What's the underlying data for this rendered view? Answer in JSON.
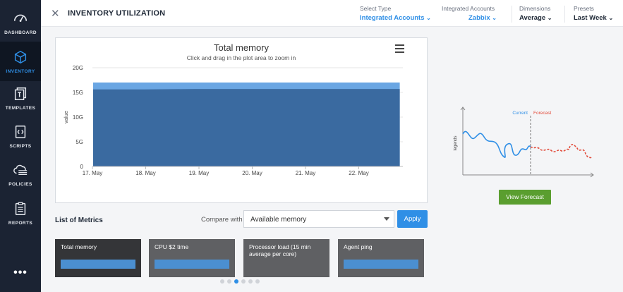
{
  "sidebar": {
    "items": [
      {
        "label": "DASHBOARD",
        "icon": "gauge-icon",
        "active": false
      },
      {
        "label": "INVENTORY",
        "icon": "cube-icon",
        "active": true
      },
      {
        "label": "TEMPLATES",
        "icon": "template-icon",
        "active": false
      },
      {
        "label": "SCRIPTS",
        "icon": "code-file-icon",
        "active": false
      },
      {
        "label": "POLICIES",
        "icon": "cloud-policy-icon",
        "active": false
      },
      {
        "label": "REPORTS",
        "icon": "clipboard-icon",
        "active": false
      }
    ],
    "more": "•••"
  },
  "header": {
    "close": "✕",
    "title": "INVENTORY UTILIZATION",
    "filters": [
      {
        "caption": "Select Type",
        "value": "Integrated Accounts",
        "blue": true
      },
      {
        "caption": "Integrated Accounts",
        "value": "Zabbix",
        "blue": true
      },
      {
        "caption": "Dimensions",
        "value": "Average",
        "blue": false
      },
      {
        "caption": "Presets",
        "value": "Last Week",
        "blue": false
      }
    ]
  },
  "chart_data": {
    "type": "area",
    "title": "Total memory",
    "subtitle": "Click and drag in the plot area to zoom in",
    "ylabel": "value",
    "xlabel": "",
    "ylim": [
      0,
      20
    ],
    "y_ticks": [
      "0",
      "5G",
      "10G",
      "15G",
      "20G"
    ],
    "x_ticks": [
      "17. May",
      "18. May",
      "19. May",
      "20. May",
      "21. May",
      "22. May"
    ],
    "series": [
      {
        "values": [
          17,
          17,
          17,
          17,
          17,
          17,
          17
        ],
        "color": "#6aa6e3"
      },
      {
        "values": [
          15.6,
          15.6,
          15.7,
          15.7,
          15.7,
          15.7,
          15.7
        ],
        "color": "#3a6aa0"
      }
    ],
    "grid": true
  },
  "forecast": {
    "ylabel": "legends",
    "current_label": "Current",
    "forecast_label": "Forecast",
    "current_color": "#2f8fe6",
    "forecast_color": "#e24b3b",
    "button": "View Forecast"
  },
  "metrics": {
    "title": "List of Metrics",
    "compare_label": "Compare with",
    "selected": "Available memory",
    "apply": "Apply",
    "cards": [
      {
        "label": "Total memory",
        "active": true
      },
      {
        "label": "CPU $2 time",
        "active": false
      },
      {
        "label": "Processor load (15 min average per core)",
        "active": false
      },
      {
        "label": "Agent ping",
        "active": false
      }
    ],
    "pages": 6,
    "current_page": 3
  },
  "colors": {
    "accent": "#2f8fe6",
    "sidebar": "#1b2333",
    "forecast_button": "#5a9e2f"
  }
}
